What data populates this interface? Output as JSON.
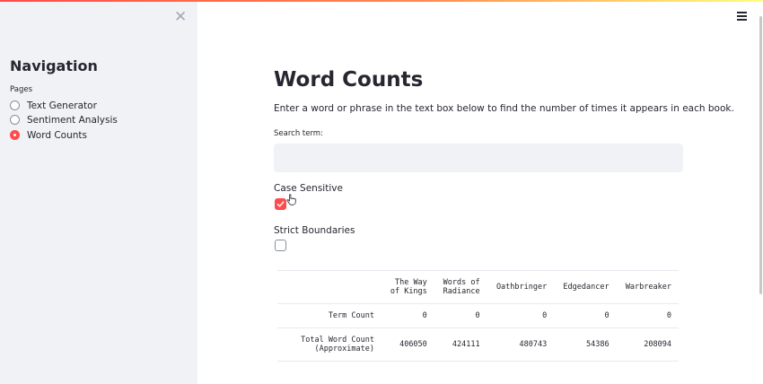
{
  "sidebar": {
    "close_icon": "✕",
    "nav_title": "Navigation",
    "pages_label": "Pages",
    "pages": [
      {
        "label": "Text Generator",
        "selected": false
      },
      {
        "label": "Sentiment Analysis",
        "selected": false
      },
      {
        "label": "Word Counts",
        "selected": true
      }
    ]
  },
  "header": {
    "menu_icon": "hamburger-icon"
  },
  "main": {
    "title": "Word Counts",
    "description": "Enter a word or phrase in the text box below to find the number of times it appears in each book.",
    "search": {
      "label": "Search term:",
      "value": "",
      "placeholder": ""
    },
    "case_sensitive": {
      "label": "Case Sensitive",
      "checked": true
    },
    "strict_boundaries": {
      "label": "Strict Boundaries",
      "checked": false
    },
    "table": {
      "headers": [
        [
          "The Way",
          "of Kings"
        ],
        [
          "Words of",
          "Radiance"
        ],
        [
          "Oathbringer"
        ],
        [
          "Edgedancer"
        ],
        [
          "Warbreaker"
        ]
      ],
      "rows": [
        {
          "name": [
            "Term Count"
          ],
          "values": [
            "0",
            "0",
            "0",
            "0",
            "0"
          ]
        },
        {
          "name": [
            "Total Word Count",
            "(Approximate)"
          ],
          "values": [
            "406050",
            "424111",
            "480743",
            "54386",
            "208094"
          ]
        }
      ]
    }
  },
  "colors": {
    "accent": "#ff4b4b",
    "sidebar_bg": "#f0f2f6",
    "text": "#262730"
  }
}
